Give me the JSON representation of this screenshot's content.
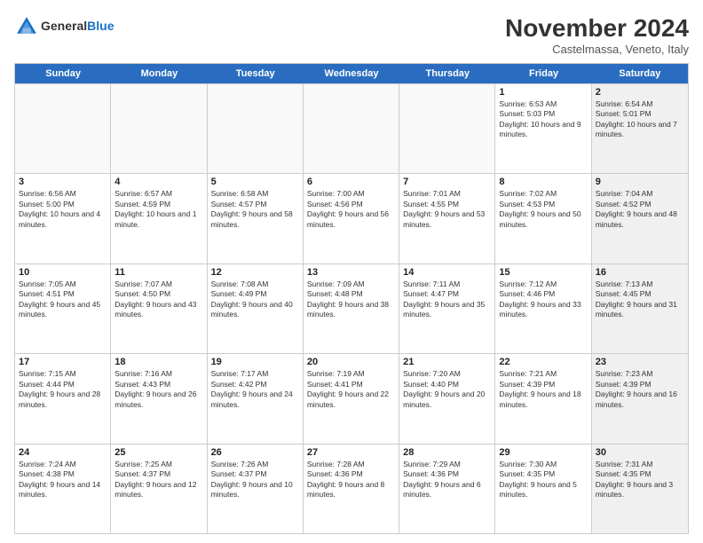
{
  "logo": {
    "general": "General",
    "blue": "Blue"
  },
  "title": "November 2024",
  "subtitle": "Castelmassa, Veneto, Italy",
  "header_days": [
    "Sunday",
    "Monday",
    "Tuesday",
    "Wednesday",
    "Thursday",
    "Friday",
    "Saturday"
  ],
  "rows": [
    [
      {
        "day": "",
        "empty": true,
        "text": ""
      },
      {
        "day": "",
        "empty": true,
        "text": ""
      },
      {
        "day": "",
        "empty": true,
        "text": ""
      },
      {
        "day": "",
        "empty": true,
        "text": ""
      },
      {
        "day": "",
        "empty": true,
        "text": ""
      },
      {
        "day": "1",
        "empty": false,
        "shaded": false,
        "text": "Sunrise: 6:53 AM\nSunset: 5:03 PM\nDaylight: 10 hours and 9 minutes."
      },
      {
        "day": "2",
        "empty": false,
        "shaded": true,
        "text": "Sunrise: 6:54 AM\nSunset: 5:01 PM\nDaylight: 10 hours and 7 minutes."
      }
    ],
    [
      {
        "day": "3",
        "empty": false,
        "shaded": false,
        "text": "Sunrise: 6:56 AM\nSunset: 5:00 PM\nDaylight: 10 hours and 4 minutes."
      },
      {
        "day": "4",
        "empty": false,
        "shaded": false,
        "text": "Sunrise: 6:57 AM\nSunset: 4:59 PM\nDaylight: 10 hours and 1 minute."
      },
      {
        "day": "5",
        "empty": false,
        "shaded": false,
        "text": "Sunrise: 6:58 AM\nSunset: 4:57 PM\nDaylight: 9 hours and 58 minutes."
      },
      {
        "day": "6",
        "empty": false,
        "shaded": false,
        "text": "Sunrise: 7:00 AM\nSunset: 4:56 PM\nDaylight: 9 hours and 56 minutes."
      },
      {
        "day": "7",
        "empty": false,
        "shaded": false,
        "text": "Sunrise: 7:01 AM\nSunset: 4:55 PM\nDaylight: 9 hours and 53 minutes."
      },
      {
        "day": "8",
        "empty": false,
        "shaded": false,
        "text": "Sunrise: 7:02 AM\nSunset: 4:53 PM\nDaylight: 9 hours and 50 minutes."
      },
      {
        "day": "9",
        "empty": false,
        "shaded": true,
        "text": "Sunrise: 7:04 AM\nSunset: 4:52 PM\nDaylight: 9 hours and 48 minutes."
      }
    ],
    [
      {
        "day": "10",
        "empty": false,
        "shaded": false,
        "text": "Sunrise: 7:05 AM\nSunset: 4:51 PM\nDaylight: 9 hours and 45 minutes."
      },
      {
        "day": "11",
        "empty": false,
        "shaded": false,
        "text": "Sunrise: 7:07 AM\nSunset: 4:50 PM\nDaylight: 9 hours and 43 minutes."
      },
      {
        "day": "12",
        "empty": false,
        "shaded": false,
        "text": "Sunrise: 7:08 AM\nSunset: 4:49 PM\nDaylight: 9 hours and 40 minutes."
      },
      {
        "day": "13",
        "empty": false,
        "shaded": false,
        "text": "Sunrise: 7:09 AM\nSunset: 4:48 PM\nDaylight: 9 hours and 38 minutes."
      },
      {
        "day": "14",
        "empty": false,
        "shaded": false,
        "text": "Sunrise: 7:11 AM\nSunset: 4:47 PM\nDaylight: 9 hours and 35 minutes."
      },
      {
        "day": "15",
        "empty": false,
        "shaded": false,
        "text": "Sunrise: 7:12 AM\nSunset: 4:46 PM\nDaylight: 9 hours and 33 minutes."
      },
      {
        "day": "16",
        "empty": false,
        "shaded": true,
        "text": "Sunrise: 7:13 AM\nSunset: 4:45 PM\nDaylight: 9 hours and 31 minutes."
      }
    ],
    [
      {
        "day": "17",
        "empty": false,
        "shaded": false,
        "text": "Sunrise: 7:15 AM\nSunset: 4:44 PM\nDaylight: 9 hours and 28 minutes."
      },
      {
        "day": "18",
        "empty": false,
        "shaded": false,
        "text": "Sunrise: 7:16 AM\nSunset: 4:43 PM\nDaylight: 9 hours and 26 minutes."
      },
      {
        "day": "19",
        "empty": false,
        "shaded": false,
        "text": "Sunrise: 7:17 AM\nSunset: 4:42 PM\nDaylight: 9 hours and 24 minutes."
      },
      {
        "day": "20",
        "empty": false,
        "shaded": false,
        "text": "Sunrise: 7:19 AM\nSunset: 4:41 PM\nDaylight: 9 hours and 22 minutes."
      },
      {
        "day": "21",
        "empty": false,
        "shaded": false,
        "text": "Sunrise: 7:20 AM\nSunset: 4:40 PM\nDaylight: 9 hours and 20 minutes."
      },
      {
        "day": "22",
        "empty": false,
        "shaded": false,
        "text": "Sunrise: 7:21 AM\nSunset: 4:39 PM\nDaylight: 9 hours and 18 minutes."
      },
      {
        "day": "23",
        "empty": false,
        "shaded": true,
        "text": "Sunrise: 7:23 AM\nSunset: 4:39 PM\nDaylight: 9 hours and 16 minutes."
      }
    ],
    [
      {
        "day": "24",
        "empty": false,
        "shaded": false,
        "text": "Sunrise: 7:24 AM\nSunset: 4:38 PM\nDaylight: 9 hours and 14 minutes."
      },
      {
        "day": "25",
        "empty": false,
        "shaded": false,
        "text": "Sunrise: 7:25 AM\nSunset: 4:37 PM\nDaylight: 9 hours and 12 minutes."
      },
      {
        "day": "26",
        "empty": false,
        "shaded": false,
        "text": "Sunrise: 7:26 AM\nSunset: 4:37 PM\nDaylight: 9 hours and 10 minutes."
      },
      {
        "day": "27",
        "empty": false,
        "shaded": false,
        "text": "Sunrise: 7:28 AM\nSunset: 4:36 PM\nDaylight: 9 hours and 8 minutes."
      },
      {
        "day": "28",
        "empty": false,
        "shaded": false,
        "text": "Sunrise: 7:29 AM\nSunset: 4:36 PM\nDaylight: 9 hours and 6 minutes."
      },
      {
        "day": "29",
        "empty": false,
        "shaded": false,
        "text": "Sunrise: 7:30 AM\nSunset: 4:35 PM\nDaylight: 9 hours and 5 minutes."
      },
      {
        "day": "30",
        "empty": false,
        "shaded": true,
        "text": "Sunrise: 7:31 AM\nSunset: 4:35 PM\nDaylight: 9 hours and 3 minutes."
      }
    ]
  ]
}
